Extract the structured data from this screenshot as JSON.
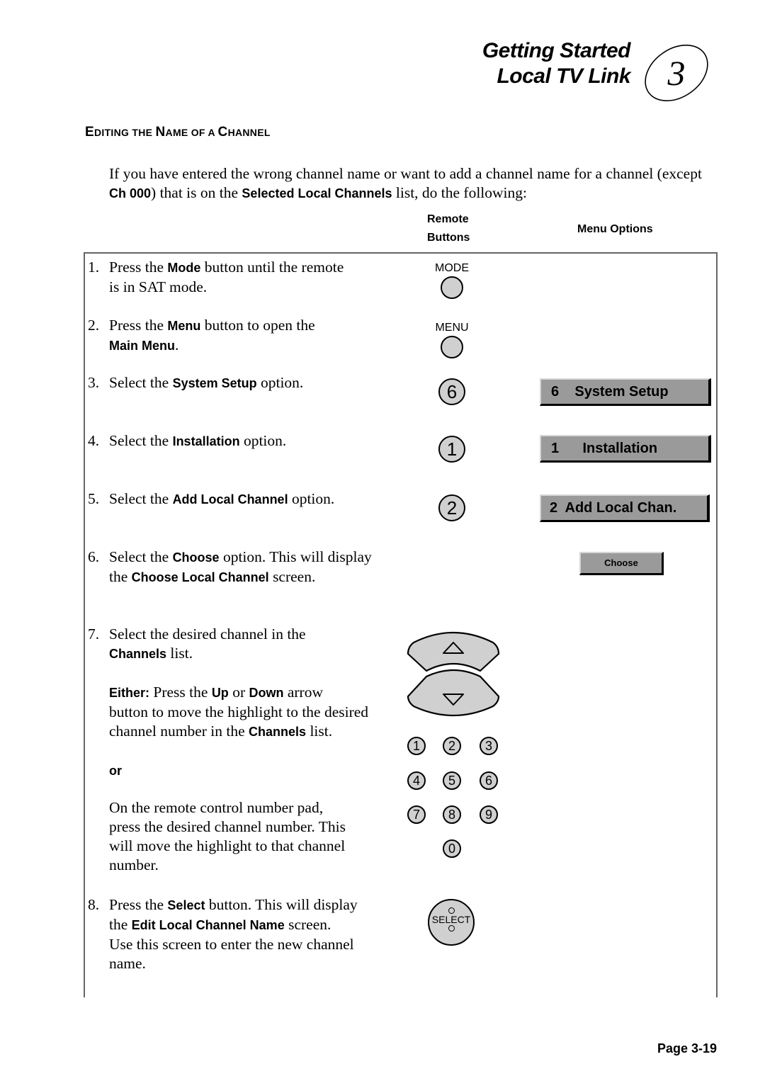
{
  "header": {
    "title_line1": "Getting Started",
    "title_line2": "Local TV Link",
    "chapter_number": "3"
  },
  "section": {
    "title_parts": [
      {
        "big": "E",
        "small": "DITING THE "
      },
      {
        "big": "N",
        "small": "AME OF A "
      },
      {
        "big": "C",
        "small": "HANNEL"
      }
    ]
  },
  "intro": {
    "t1": "If you have entered the wrong channel name or want to add a channel name for a channel (except ",
    "b1": "Ch 000",
    "t2": ") that is on the ",
    "b2": "Selected Local Channels",
    "t3": " list, do the following:"
  },
  "columns": {
    "remote_line1": "Remote",
    "remote_line2": "Buttons",
    "menu_options": "Menu Options"
  },
  "steps": [
    {
      "num": "1.",
      "t1": "Press the ",
      "b1": "Mode",
      "t2": " button until the remote",
      "line2": "is in SAT mode."
    },
    {
      "num": "2.",
      "t1": "Press the ",
      "b1": "Menu",
      "t2": " button to open the",
      "line2_b": "Main Menu",
      "line2_t": "."
    },
    {
      "num": "3.",
      "t1": "Select the ",
      "b1": "System Setup",
      "t2": " option."
    },
    {
      "num": "4.",
      "t1": "Select the ",
      "b1": "Installation",
      "t2": " option."
    },
    {
      "num": "5.",
      "t1": "Select the ",
      "b1": "Add Local Channel",
      "t2": " option."
    },
    {
      "num": "6.",
      "t1": "Select the ",
      "b1": "Choose",
      "t2": " option.  This will display",
      "line2_t1": "the ",
      "line2_b": "Choose Local Channel",
      "line2_t2": " screen."
    },
    {
      "num": "7.",
      "t1": "Select the desired channel in the",
      "line2_b": "Channels",
      "line2_t": " list.",
      "either_b": "Either:",
      "either_t1": "  Press the ",
      "either_b2": "Up",
      "either_t2": " or ",
      "either_b3": "Down",
      "either_t3": " arrow",
      "either_line2": "button to move the highlight to the desired",
      "either_line3_t": "channel number in the ",
      "either_line3_b": "Channels",
      "either_line3_t2": " list.",
      "or": "or",
      "pad_line1": "On the remote control number pad,",
      "pad_line2": "press the desired channel number.  This",
      "pad_line3": "will move the highlight to that channel",
      "pad_line4": "number."
    },
    {
      "num": "8.",
      "t1": "Press the ",
      "b1": "Select",
      "t2": " button.  This will display",
      "line2_t1": "the ",
      "line2_b": "Edit Local Channel Name",
      "line2_t2": " screen.",
      "line3": "Use this screen to enter the new channel",
      "line4": "name."
    }
  ],
  "remote": {
    "mode_label": "MODE",
    "menu_label": "MENU",
    "key_step3": "6",
    "key_step4": "1",
    "key_step5": "2",
    "numpad": [
      "1",
      "2",
      "3",
      "4",
      "5",
      "6",
      "7",
      "8",
      "9",
      "0"
    ],
    "select_label": "SELECT"
  },
  "menu": {
    "system_setup": "6    System Setup",
    "installation": "1      Installation",
    "add_local": "2  Add Local Chan.",
    "choose": "Choose"
  },
  "footer": {
    "page": "Page 3-19"
  }
}
